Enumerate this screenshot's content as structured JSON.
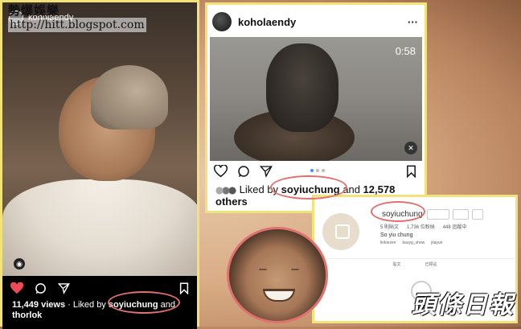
{
  "watermark": {
    "line1": "勢爆娛樂",
    "line2": "http://hitt.blogspot.com"
  },
  "post_left": {
    "username": "koholaendy",
    "views": "11,449 views",
    "liked_prefix": " · Liked by ",
    "liked_user": "soyiuchung",
    "liked_and": " and",
    "second_user": "thorlok"
  },
  "post_right": {
    "username": "koholaendy",
    "more": "···",
    "duration": "0:58",
    "liked_prefix": "Liked by ",
    "liked_user": "soyiuchung",
    "liked_and": " and ",
    "liked_count": "12,578",
    "liked_suffix": "others"
  },
  "profile": {
    "username": "soyiuchung",
    "posts": "5 則貼文",
    "followers": "1,736 位粉絲",
    "following": "448 追蹤中",
    "real_name": "So yiu chung",
    "tag1": "linkiezen",
    "tag2": "kauyg_show",
    "tag3": "jiiayun",
    "tab1": "貼文",
    "tab2": "已標註"
  },
  "logo": "頭條日報",
  "colors": {
    "highlight": "#e0716f",
    "frame": "#f2e27a",
    "like_red": "#ed4956",
    "dot_blue": "#3897f0"
  },
  "icons": [
    "heart-icon",
    "comment-icon",
    "share-icon",
    "save-icon",
    "mute-icon",
    "more-icon",
    "camera-icon"
  ]
}
